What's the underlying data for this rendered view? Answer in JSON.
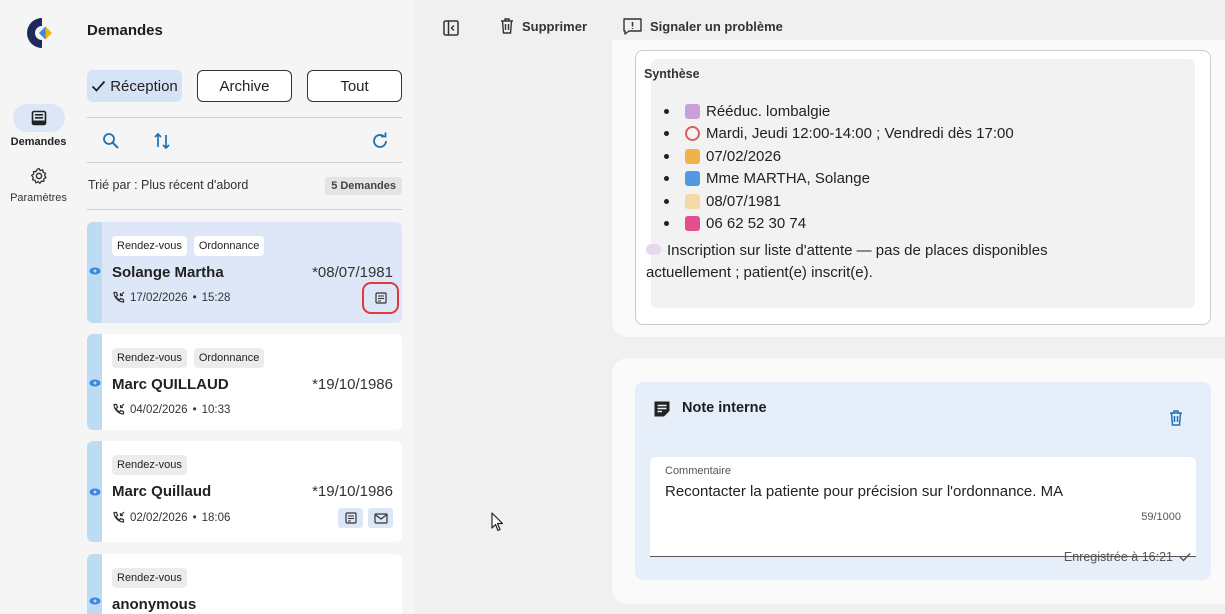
{
  "nav": {
    "items": [
      {
        "label": "Demandes",
        "icon": "inbox-icon",
        "active": true
      },
      {
        "label": "Paramètres",
        "icon": "gear-icon",
        "active": false
      }
    ]
  },
  "list": {
    "title": "Demandes",
    "filters": [
      {
        "label": "Réception",
        "active": true
      },
      {
        "label": "Archive",
        "active": false
      },
      {
        "label": "Tout",
        "active": false
      }
    ],
    "sort_label": "Trié par : Plus récent d'abord",
    "count_badge": "5 Demandes",
    "cards": [
      {
        "tags": [
          "Rendez-vous",
          "Ordonnance"
        ],
        "name": "Solange Martha",
        "dob": "*08/07/1981",
        "date": "17/02/2026",
        "time": "15:28",
        "selected": true
      },
      {
        "tags": [
          "Rendez-vous",
          "Ordonnance"
        ],
        "name": "Marc QUILLAUD",
        "dob": "*19/10/1986",
        "date": "04/02/2026",
        "time": "10:33",
        "selected": false
      },
      {
        "tags": [
          "Rendez-vous"
        ],
        "name": "Marc Quillaud",
        "dob": "*19/10/1986",
        "date": "02/02/2026",
        "time": "18:06",
        "selected": false
      },
      {
        "tags": [
          "Rendez-vous"
        ],
        "name": "anonymous",
        "dob": "",
        "date": "",
        "time": "",
        "selected": false
      }
    ],
    "separator": "•"
  },
  "topbar": {
    "delete_label": "Supprimer",
    "report_label": "Signaler un problème"
  },
  "synthese": {
    "title": "Synthèse",
    "items": [
      "Rééduc. lombalgie",
      "Mardi, Jeudi 12:00-14:00 ; Vendredi dès 17:00",
      "07/02/2026",
      "Mme MARTHA, Solange",
      "08/07/1981",
      "06 62 52 30 74"
    ],
    "note": "Inscription sur liste d'attente — pas de places disponibles actuellement ; patient(e) inscrit(e)."
  },
  "note_interne": {
    "title": "Note interne",
    "field_label": "Commentaire",
    "value": "Recontacter la patiente pour précision sur l'ordonnance. MA",
    "count": "59/1000",
    "saved": "Enregistrée à 16:21"
  },
  "colors": {
    "accent": "#1a73b8",
    "selected_card": "#dde7f7",
    "stripe": "#bcdcf3",
    "highlight": "#e0393e"
  }
}
